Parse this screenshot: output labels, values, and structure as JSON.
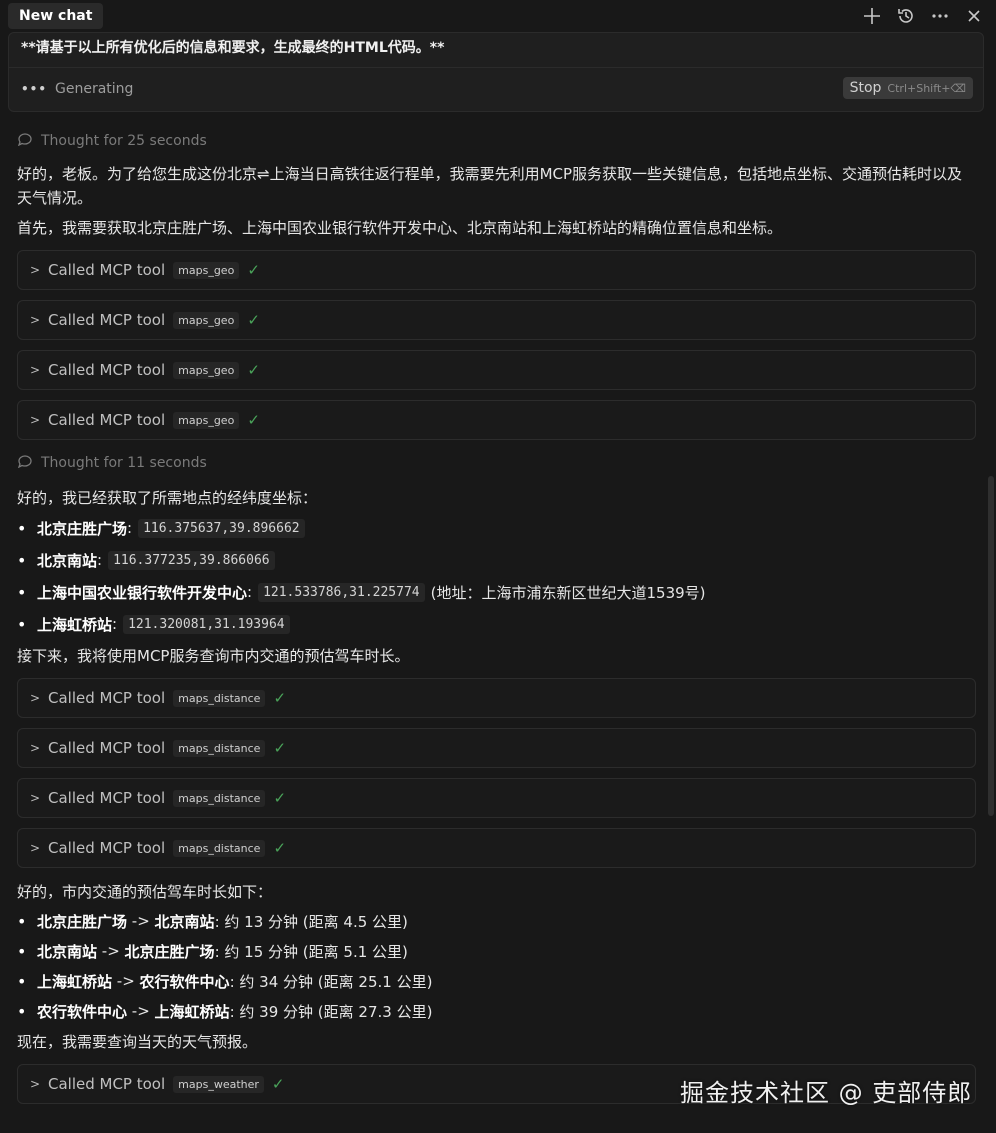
{
  "header": {
    "tab_title": "New chat",
    "icons": [
      "plus-icon",
      "history-icon",
      "more-icon",
      "close-icon"
    ]
  },
  "prompt": {
    "text": "**请基于以上所有优化后的信息和要求，生成最终的HTML代码。**",
    "status": "Generating",
    "stop_label": "Stop",
    "stop_shortcut": "Ctrl+Shift+⌫"
  },
  "thought1": "Thought for 25 seconds",
  "intro": {
    "p1": "好的，老板。为了给您生成这份北京⇌上海当日高铁往返行程单，我需要先利用MCP服务获取一些关键信息，包括地点坐标、交通预估耗时以及天气情况。",
    "p2": "首先，我需要获取北京庄胜广场、上海中国农业银行软件开发中心、北京南站和上海虹桥站的精确位置信息和坐标。"
  },
  "tool_label": "Called MCP tool",
  "geo_tools": [
    "maps_geo",
    "maps_geo",
    "maps_geo",
    "maps_geo"
  ],
  "thought2": "Thought for 11 seconds",
  "coords_intro": "好的，我已经获取了所需地点的经纬度坐标：",
  "coords": [
    {
      "name": "北京庄胜广场",
      "value": "116.375637,39.896662",
      "extra": ""
    },
    {
      "name": "北京南站",
      "value": "116.377235,39.866066",
      "extra": ""
    },
    {
      "name": "上海中国农业银行软件开发中心",
      "value": "121.533786,31.225774",
      "extra": "(地址：上海市浦东新区世纪大道1539号)"
    },
    {
      "name": "上海虹桥站",
      "value": "121.320081,31.193964",
      "extra": ""
    }
  ],
  "distance_intro": "接下来，我将使用MCP服务查询市内交通的预估驾车时长。",
  "distance_tools": [
    "maps_distance",
    "maps_distance",
    "maps_distance",
    "maps_distance"
  ],
  "drive_intro": "好的，市内交通的预估驾车时长如下：",
  "drives": [
    {
      "from": "北京庄胜广场",
      "to": "北京南站",
      "detail": ": 约 13 分钟 (距离 4.5 公里)"
    },
    {
      "from": "北京南站",
      "to": "北京庄胜广场",
      "detail": ": 约 15 分钟 (距离 5.1 公里)"
    },
    {
      "from": "上海虹桥站",
      "to": "农行软件中心",
      "detail": ": 约 34 分钟 (距离 25.1 公里)"
    },
    {
      "from": "农行软件中心",
      "to": "上海虹桥站",
      "detail": ": 约 39 分钟 (距离 27.3 公里)"
    }
  ],
  "weather_intro": "现在，我需要查询当天的天气预报。",
  "weather_tool": "maps_weather",
  "arrow": " -> ",
  "watermark": "掘金技术社区 @ 吏部侍郎"
}
